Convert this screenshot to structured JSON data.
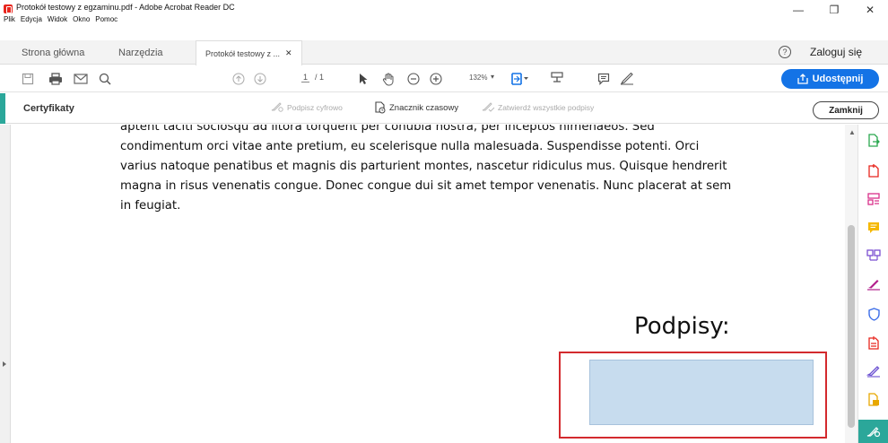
{
  "window": {
    "title": "Protokół testowy z egzaminu.pdf - Adobe Acrobat Reader DC",
    "menu": [
      "Plik",
      "Edycja",
      "Widok",
      "Okno",
      "Pomoc"
    ],
    "controls": {
      "minimize": "—",
      "maximize": "❐",
      "close": "✕"
    }
  },
  "tabs": {
    "home": "Strona główna",
    "tools": "Narzędzia",
    "document": "Protokół testowy z ...",
    "document_close": "✕",
    "help": "?",
    "login": "Zaloguj się"
  },
  "toolbar": {
    "page_current": "1",
    "page_total": "/ 1",
    "zoom": "132%",
    "zoom_arrow": "▾",
    "share_label": "Udostępnij",
    "icons": [
      "save-icon",
      "print-icon",
      "email-icon",
      "search-icon",
      "page-up-icon",
      "page-down-icon",
      "select-pointer-icon",
      "hand-tool-icon",
      "zoom-out-icon",
      "zoom-in-icon",
      "fit-page-icon",
      "stamp-icon",
      "comment-icon",
      "sign-pen-icon"
    ]
  },
  "certificates": {
    "label": "Certyfikaty",
    "sign_digitally": "Podpisz cyfrowo",
    "timestamp": "Znacznik czasowy",
    "validate_all": "Zatwierdź wszystkie podpisy",
    "close": "Zamknij"
  },
  "document": {
    "lines": [
      "aptent taciti sociosqu ad litora torquent per conubia nostra, per inceptos himenaeos. Sed",
      "condimentum orci vitae ante pretium, eu scelerisque nulla malesuada. Suspendisse potenti. Orci",
      "varius natoque penatibus et magnis dis parturient montes, nascetur ridiculus mus. Quisque hendrerit",
      "magna in risus venenatis congue. Donec congue dui sit amet tempor venenatis. Nunc placerat at sem",
      "in feugiat."
    ],
    "signatures_heading": "Podpisy:"
  },
  "colors": {
    "accent_teal": "#2ba79a",
    "share_blue": "#1473e6",
    "signature_border": "#d32a2e",
    "signature_field": "#c7dcee"
  }
}
